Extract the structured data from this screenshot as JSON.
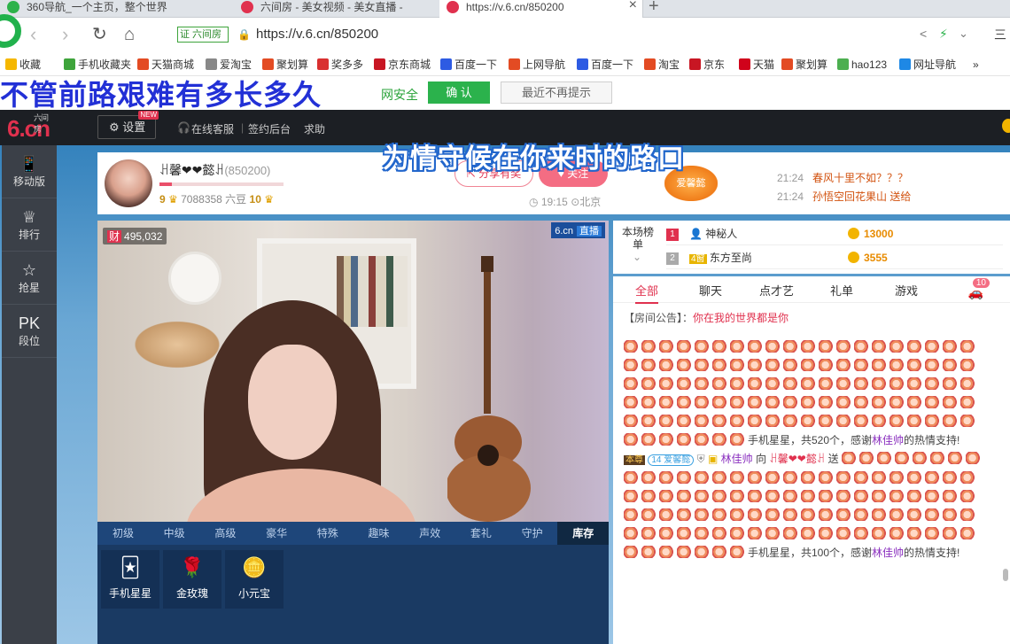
{
  "browser": {
    "tabs": [
      {
        "title": "360导航_一个主页，整个世界",
        "active": false
      },
      {
        "title": "六间房 - 美女视频 - 美女直播 - ",
        "active": false
      },
      {
        "title": "https://v.6.cn/850200",
        "active": true
      }
    ],
    "cert_label": "证 六间房",
    "url": "https://v.6.cn/850200",
    "right_menu": "三",
    "bookmarks": [
      "收藏",
      "手机收藏夹",
      "天猫商城",
      "爱淘宝",
      "聚划算",
      "奖多多",
      "京东商城",
      "百度一下",
      "上网导航",
      "百度一下",
      "淘宝",
      "京东",
      "天猫",
      "聚划算",
      "hao123",
      "网址导航"
    ],
    "bookmarks_more": "»",
    "security_msg": "网安全",
    "ok_label": "确 认",
    "dismiss_label": "最近不再提示"
  },
  "subtitles": {
    "line1": "不管前路艰难有多长多久",
    "line2": "为情守候在你来时的路口"
  },
  "site": {
    "logo_text": "6.cn",
    "logo_small": "六间房",
    "settings_label": "设置",
    "new_tag": "NEW",
    "nav_links": [
      "在线客服",
      "签约后台",
      "求助"
    ],
    "sidebar": [
      {
        "icon": "mobile-icon",
        "label": "移动版",
        "glyph": "📱"
      },
      {
        "icon": "crown-icon",
        "label": "排行",
        "glyph": "♕"
      },
      {
        "icon": "star-icon",
        "label": "抢星",
        "glyph": "☆"
      },
      {
        "icon": "pk-icon",
        "label": "段位",
        "glyph": "PK"
      }
    ]
  },
  "host": {
    "name": "ꃅ馨❤❤懿ꃅ",
    "room_id": "(850200)",
    "level1": "9",
    "beans": "7088358 六豆",
    "level2": "10",
    "progress": 0.1,
    "share_label": "分享有奖",
    "follow_label": "关注",
    "time": "19:15",
    "location": "北京",
    "badge": "爱馨懿"
  },
  "top_chat": [
    {
      "time": "21:24",
      "text": "春风十里不如？？？"
    },
    {
      "time": "21:24",
      "text": "孙悟空回花果山 送给"
    }
  ],
  "video": {
    "viewer_label": "财",
    "viewers": "495,032",
    "logo": "6.cn",
    "live": "直播"
  },
  "gift_tabs": [
    "初级",
    "中级",
    "高级",
    "豪华",
    "特殊",
    "趣味",
    "声效",
    "套礼",
    "守护",
    "库存"
  ],
  "gift_active": "库存",
  "gifts": [
    {
      "icon": "phone-star-icon",
      "glyph": "🃏",
      "label": "手机星星"
    },
    {
      "icon": "gold-rose-icon",
      "glyph": "🌹",
      "label": "金玫瑰"
    },
    {
      "icon": "ingot-icon",
      "glyph": "🪙",
      "label": "小元宝"
    }
  ],
  "ranking": {
    "title": "本场榜单",
    "rows": [
      {
        "rank": "1",
        "name": "神秘人",
        "coins": "13000",
        "color": "#e0314e"
      },
      {
        "rank": "2",
        "name": "东方至尚",
        "coins": "3555",
        "color": "#aaaaaa"
      }
    ]
  },
  "chat_tabs": [
    "全部",
    "聊天",
    "点才艺",
    "礼单",
    "游戏"
  ],
  "chat_badge": "10",
  "notice_prefix": "【房间公告】：",
  "notice_text": "你在我的世界都是你",
  "messages": [
    {
      "gift_count": 107,
      "text": "手机星星，共520个，感谢",
      "user": "林佳帅",
      "suffix": "的热情支持!"
    },
    {
      "gift_count": 87,
      "text": "手机星星，共100个，感谢",
      "user": "林佳帅",
      "suffix": "的热情支持!"
    }
  ],
  "send_line": {
    "from": "林佳帅",
    "to_word": "向",
    "to": "ꃅ馨❤❤懿ꃅ",
    "verb": "送"
  }
}
